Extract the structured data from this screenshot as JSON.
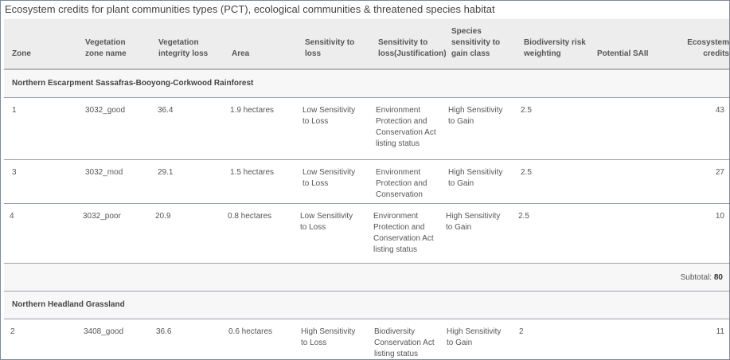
{
  "title": "Ecosystem credits for plant communities types (PCT), ecological communities & threatened species habitat",
  "columns": {
    "zone": "Zone",
    "vegetation_zone_name": "Vegetation zone name",
    "vegetation_integrity_loss": "Vegetation integrity loss",
    "area": "Area",
    "sensitivity_to_loss": "Sensitivity to loss",
    "sensitivity_justification": "Sensitivity to loss(Justification)",
    "species_sensitivity_gain": "Species sensitivity to gain class",
    "biodiversity_risk": "Biodiversity risk weighting",
    "potential_sail": "Potential SAII",
    "ecosystem_credits": "Ecosystem credits"
  },
  "groups": [
    {
      "name": "Northern Escarpment Sassafras-Booyong-Corkwood Rainforest",
      "rows": [
        {
          "zone": "1",
          "veg": "3032_good",
          "loss": "36.4",
          "area": "1.9 hectares",
          "sens": "Low Sensitivity to Loss",
          "just": "Environment Protection and Conservation Act listing status",
          "gain": "High Sensitivity to Gain",
          "risk": "2.5",
          "sail": "",
          "credits": "43"
        },
        {
          "zone": "3",
          "veg": "3032_mod",
          "loss": "29.1",
          "area": "1.5 hectares",
          "sens": "Low Sensitivity to Loss",
          "just": "Environment Protection and Conservation",
          "gain": "High Sensitivity to Gain",
          "risk": "2.5",
          "sail": "",
          "credits": "27"
        },
        {
          "zone": "4",
          "veg": "3032_poor",
          "loss": "20.9",
          "area": "0.8 hectares",
          "sens": "Low Sensitivity to Loss",
          "just": "Environment Protection and Conservation Act listing status",
          "gain": "High Sensitivity to Gain",
          "risk": "2.5",
          "sail": "",
          "credits": "10"
        }
      ],
      "subtotal_label": "Subtotal:",
      "subtotal_value": "80"
    },
    {
      "name": "Northern Headland Grassland",
      "rows": [
        {
          "zone": "2",
          "veg": "3408_good",
          "loss": "36.6",
          "area": "0.6 hectares",
          "sens": "High Sensitivity to Loss",
          "just": "Biodiversity Conservation Act listing status",
          "gain": "High Sensitivity to Gain",
          "risk": "2",
          "sail": "",
          "credits": "11"
        }
      ]
    }
  ]
}
